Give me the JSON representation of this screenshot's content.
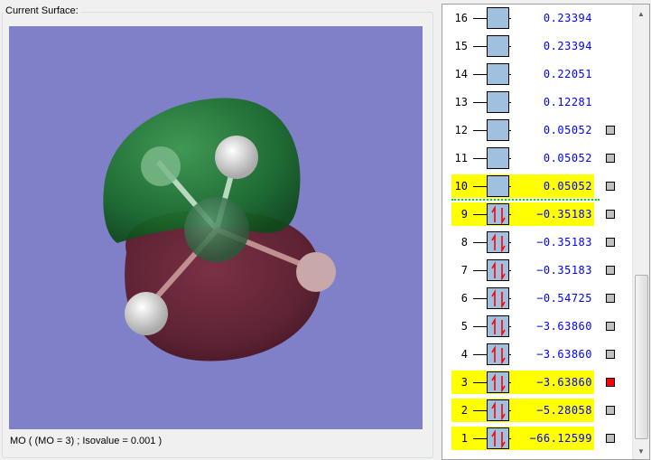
{
  "surface_panel": {
    "title": "Current Surface:",
    "caption": "MO ( (MO = 3) ; Isovalue = 0.001 )",
    "background_color": "#8080c8"
  },
  "orbitals": [
    {
      "n": "16",
      "energy": "0.23394",
      "occupied": false,
      "highlight": false,
      "checkbox": null
    },
    {
      "n": "15",
      "energy": "0.23394",
      "occupied": false,
      "highlight": false,
      "checkbox": null
    },
    {
      "n": "14",
      "energy": "0.22051",
      "occupied": false,
      "highlight": false,
      "checkbox": null
    },
    {
      "n": "13",
      "energy": "0.12281",
      "occupied": false,
      "highlight": false,
      "checkbox": null
    },
    {
      "n": "12",
      "energy": "0.05052",
      "occupied": false,
      "highlight": false,
      "checkbox": "off"
    },
    {
      "n": "11",
      "energy": "0.05052",
      "occupied": false,
      "highlight": false,
      "checkbox": "off"
    },
    {
      "n": "10",
      "energy": "0.05052",
      "occupied": false,
      "highlight": true,
      "checkbox": "off"
    },
    {
      "n": "9",
      "energy": "−0.35183",
      "occupied": true,
      "highlight": true,
      "checkbox": "off"
    },
    {
      "n": "8",
      "energy": "−0.35183",
      "occupied": true,
      "highlight": false,
      "checkbox": "off"
    },
    {
      "n": "7",
      "energy": "−0.35183",
      "occupied": true,
      "highlight": false,
      "checkbox": "off"
    },
    {
      "n": "6",
      "energy": "−0.54725",
      "occupied": true,
      "highlight": false,
      "checkbox": "off"
    },
    {
      "n": "5",
      "energy": "−3.63860",
      "occupied": true,
      "highlight": false,
      "checkbox": "off"
    },
    {
      "n": "4",
      "energy": "−3.63860",
      "occupied": true,
      "highlight": false,
      "checkbox": "off"
    },
    {
      "n": "3",
      "energy": "−3.63860",
      "occupied": true,
      "highlight": true,
      "checkbox": "on"
    },
    {
      "n": "2",
      "energy": "−5.28058",
      "occupied": true,
      "highlight": true,
      "checkbox": "off"
    },
    {
      "n": "1",
      "energy": "−66.12599",
      "occupied": true,
      "highlight": true,
      "checkbox": "off"
    }
  ],
  "colors": {
    "highlight": "#ffff00",
    "energy_text": "#0000ff",
    "selected_checkbox": "#ff0000",
    "homo_lumo_separator": "#00e000"
  }
}
